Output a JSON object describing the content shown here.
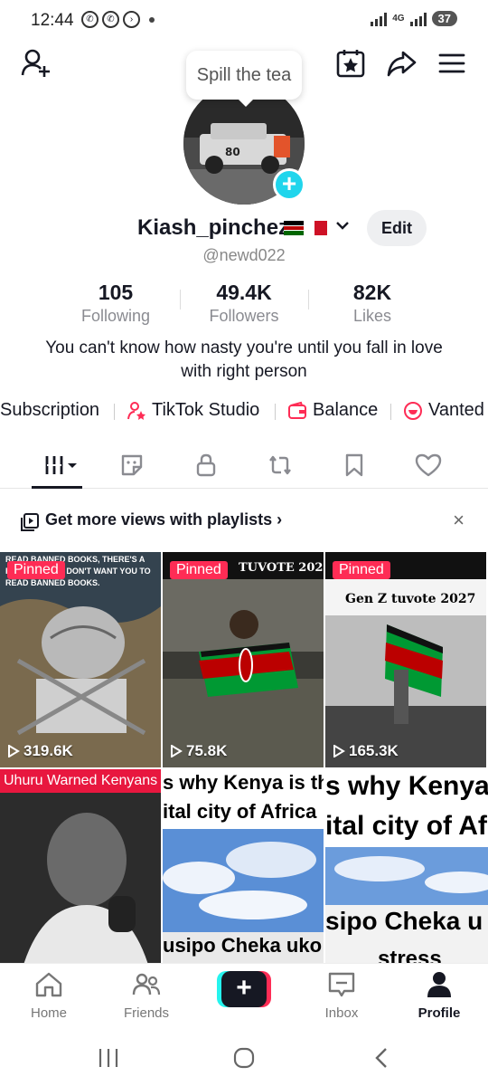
{
  "status_bar": {
    "time": "12:44",
    "net": "4G",
    "battery": "37"
  },
  "tooltip": "Spill the tea",
  "profile": {
    "username": "Kiash_pinchez",
    "handle": "@newd022",
    "edit_label": "Edit",
    "bio": "You can't know how nasty you're until you fall in love with right person"
  },
  "stats": [
    {
      "value": "105",
      "label": "Following"
    },
    {
      "value": "49.4K",
      "label": "Followers"
    },
    {
      "value": "82K",
      "label": "Likes"
    }
  ],
  "links": [
    "Subscription",
    "TikTok Studio",
    "Balance",
    "Vanted"
  ],
  "promo": {
    "text": "Get more views with playlists",
    "close": "×"
  },
  "videos": [
    {
      "pinned": "Pinned",
      "views": "319.6K",
      "caption": "READ BANNED BOOKS, THERE'S A REASON THEY DON'T WANT YOU TO READ BANNED BOOKS."
    },
    {
      "pinned": "Pinned",
      "views": "75.8K",
      "caption": "TUVOTE 2027"
    },
    {
      "pinned": "Pinned",
      "views": "165.3K",
      "caption": "Gen Z tuvote 2027"
    },
    {
      "banner": "Uhuru Warned Kenyans"
    },
    {
      "caption_top": "s why Kenya is th",
      "caption_mid": "ital city of Africa",
      "caption_bottom": "usipo Cheka uko"
    },
    {
      "caption_top": "s why Kenya",
      "caption_mid": "ital city of Af",
      "caption_bottom": "sipo Cheka u",
      "caption_extra": "stress"
    }
  ],
  "bottom_nav": [
    {
      "label": "Home",
      "active": false
    },
    {
      "label": "Friends",
      "active": false
    },
    {
      "label": "Inbox",
      "active": false
    },
    {
      "label": "Profile",
      "active": true
    }
  ],
  "colors": {
    "accent": "#fe2c55",
    "cyan": "#25f4ee",
    "text": "#161823",
    "muted": "#8a8b91"
  }
}
